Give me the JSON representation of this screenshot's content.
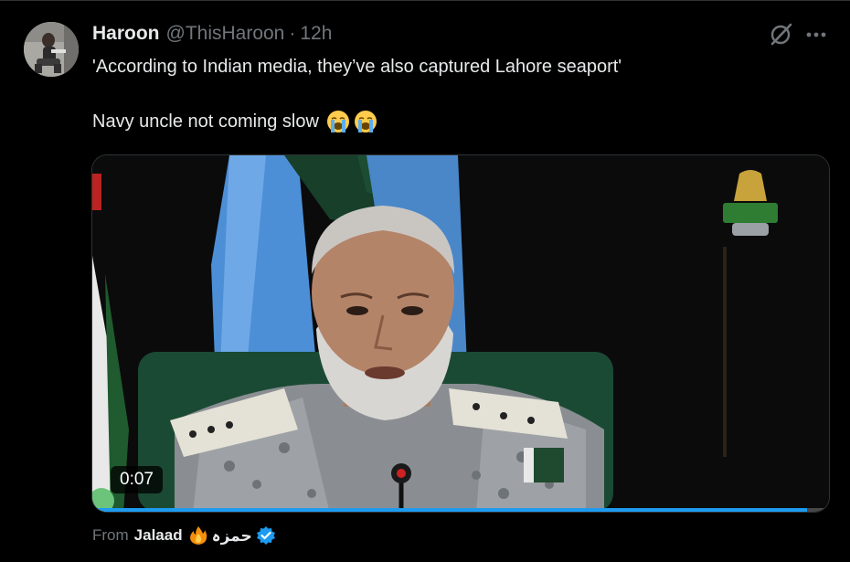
{
  "tweet": {
    "author_name": "Haroon",
    "handle": "@ThisHaroon",
    "separator": "·",
    "time": "12h",
    "text_line1": "'According to Indian media, they’ve also captured Lahore seaport'",
    "text_line2": "Navy uncle not coming slow",
    "emoji": [
      "loudly-crying-face",
      "loudly-crying-face"
    ]
  },
  "video": {
    "duration": "0:07",
    "progress": 0.97
  },
  "source": {
    "from_label": "From",
    "name": "Jalaad",
    "name_arabic": "حمزہ",
    "verified": true
  },
  "colors": {
    "background": "#000000",
    "text": "#e7e9ea",
    "secondary": "#71767b",
    "accent": "#1d9bf0",
    "divider": "#2f3336"
  },
  "icons": {
    "grok": "grok-icon",
    "more": "more-icon",
    "verified": "verified-badge-icon",
    "fire": "fire-emoji-icon"
  }
}
